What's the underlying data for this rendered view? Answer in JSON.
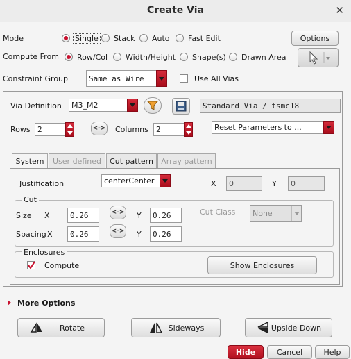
{
  "window": {
    "title": "Create Via",
    "close_icon": "close-icon"
  },
  "mode": {
    "label": "Mode",
    "options": [
      "Single",
      "Stack",
      "Auto",
      "Fast Edit"
    ],
    "selected": "Single",
    "options_button": "Options"
  },
  "compute_from": {
    "label": "Compute From",
    "options": [
      "Row/Col",
      "Width/Height",
      "Shape(s)",
      "Drawn Area"
    ],
    "selected": "Row/Col"
  },
  "constraint_group": {
    "label": "Constraint Group",
    "value": "Same as Wire",
    "use_all_vias": "Use All Vias",
    "use_all_vias_checked": false
  },
  "via_definition": {
    "label": "Via Definition",
    "value": "M3_M2",
    "via_name": "Standard Via / tsmc18"
  },
  "rows": {
    "label": "Rows",
    "value": "2"
  },
  "columns": {
    "label": "Columns",
    "value": "2"
  },
  "swap": "<->",
  "reset": {
    "value": "Reset Parameters to ..."
  },
  "tabs": [
    {
      "label": "System",
      "enabled": true,
      "active": true
    },
    {
      "label": "User defined",
      "enabled": false,
      "active": false
    },
    {
      "label": "Cut pattern",
      "enabled": true,
      "active": false
    },
    {
      "label": "Array pattern",
      "enabled": false,
      "active": false
    }
  ],
  "justification": {
    "label": "Justification",
    "value": "centerCenter",
    "x_label": "X",
    "x_value": "0",
    "y_label": "Y",
    "y_value": "0"
  },
  "cut": {
    "title": "Cut",
    "size_label": "Size",
    "spacing_label": "Spacing",
    "x_label": "X",
    "y_label": "Y",
    "size_x": "0.26",
    "size_y": "0.26",
    "spacing_x": "0.26",
    "spacing_y": "0.26",
    "cut_class_label": "Cut Class",
    "cut_class_value": "None"
  },
  "enclosures": {
    "title": "Enclosures",
    "compute_label": "Compute",
    "compute_checked": true,
    "show_button": "Show Enclosures"
  },
  "more_options": "More Options",
  "actions": {
    "rotate": "Rotate",
    "sideways": "Sideways",
    "upside_down": "Upside Down"
  },
  "footer": {
    "hide": "Hide",
    "cancel": "Cancel",
    "help": "Help"
  },
  "colors": {
    "accent": "#c8102e",
    "panel_bg": "#f4f4f4"
  }
}
